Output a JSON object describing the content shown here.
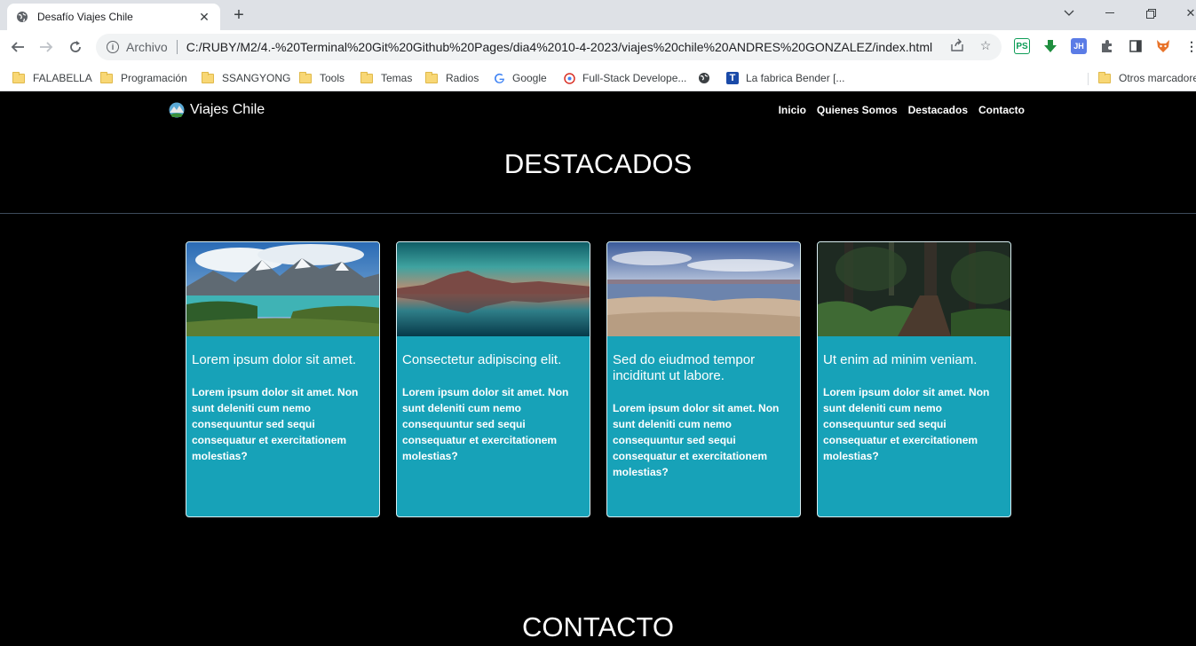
{
  "browser": {
    "tab_title": "Desafío Viajes Chile",
    "address_prefix": "Archivo",
    "url": "C:/RUBY/M2/4.-%20Terminal%20Git%20Github%20Pages/dia4%2010-4-2023/viajes%20chile%20ANDRES%20GONZALEZ/index.html",
    "bookmarks": [
      {
        "label": "FALABELLA",
        "icon": "folder-icon"
      },
      {
        "label": "Programación",
        "icon": "folder-icon"
      },
      {
        "label": "SSANGYONG",
        "icon": "folder-icon"
      },
      {
        "label": "Tools",
        "icon": "folder-icon"
      },
      {
        "label": "Temas",
        "icon": "folder-icon"
      },
      {
        "label": "Radios",
        "icon": "folder-icon"
      },
      {
        "label": "Google",
        "icon": "google-icon"
      },
      {
        "label": "Full-Stack Develope...",
        "icon": "fullstack-icon"
      },
      {
        "label": "",
        "icon": "globe-icon"
      },
      {
        "label": "La fabrica Bender [...",
        "icon": "bender-icon"
      }
    ],
    "other_bookmarks": "Otros marcadores"
  },
  "site": {
    "brand": "Viajes Chile",
    "nav": [
      "Inicio",
      "Quienes Somos",
      "Destacados",
      "Contacto"
    ],
    "section_title": "DESTACADOS",
    "next_section_title": "CONTACTO",
    "cards": [
      {
        "title": "Lorem ipsum dolor sit amet.",
        "text": "Lorem ipsum dolor sit amet. Non sunt deleniti cum nemo consequuntur sed sequi consequatur et exercitationem molestias?",
        "image": "mountains-lake-photo"
      },
      {
        "title": "Consectetur adipiscing elit.",
        "text": "Lorem ipsum dolor sit amet. Non sunt deleniti cum nemo consequuntur sed sequi consequatur et exercitationem molestias?",
        "image": "volcano-reflection-photo"
      },
      {
        "title": "Sed do eiudmod tempor inciditunt ut labore.",
        "text": "Lorem ipsum dolor sit amet. Non sunt deleniti cum nemo consequuntur sed sequi consequatur et exercitationem molestias?",
        "image": "salt-flat-photo"
      },
      {
        "title": "Ut enim ad minim veniam.",
        "text": "Lorem ipsum dolor sit amet. Non sunt deleniti cum nemo consequuntur sed sequi consequatur et exercitationem molestias?",
        "image": "forest-path-photo"
      }
    ]
  },
  "colors": {
    "card_bg": "#17a2b8",
    "page_bg": "#000000"
  }
}
